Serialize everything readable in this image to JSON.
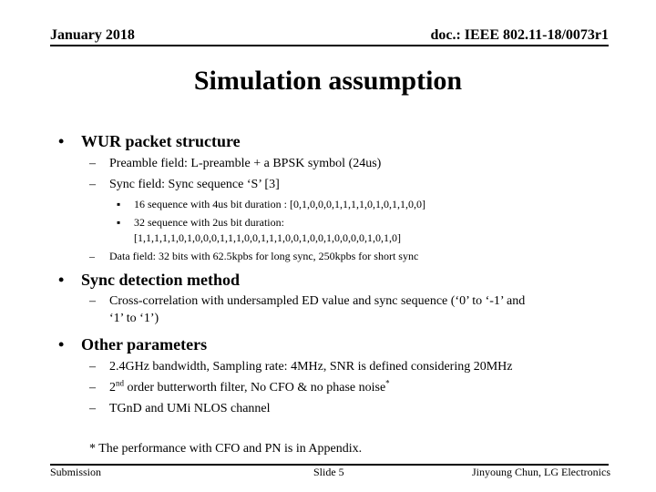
{
  "header": {
    "date": "January 2018",
    "doc_id": "doc.: IEEE 802.11-18/0073r1"
  },
  "title": "Simulation assumption",
  "sections": [
    {
      "heading": "WUR packet structure",
      "items": [
        "Preamble field: L-preamble + a BPSK symbol (24us)",
        "Sync field: Sync sequence ‘S’ [3]"
      ],
      "sub_items": [
        "16 sequence with 4us bit duration : [0,1,0,0,0,1,1,1,1,0,1,0,1,1,0,0]",
        "32 sequence with 2us bit duration:",
        "[1,1,1,1,1,0,1,0,0,0,1,1,1,0,0,1,1,1,0,0,1,0,0,1,0,0,0,0,1,0,1,0]"
      ],
      "items_after": [
        "Data field: 32 bits with 62.5kpbs for long sync, 250kpbs for short sync"
      ]
    },
    {
      "heading": "Sync detection method",
      "items": [
        "Cross-correlation with undersampled ED value and sync sequence (‘0’ to ‘-1’ and",
        "‘1’ to ‘1’)"
      ]
    },
    {
      "heading": "Other parameters",
      "items": [
        "2.4GHz bandwidth, Sampling rate: 4MHz, SNR is defined considering 20MHz",
        "2",
        "nd",
        " order butterworth filter, No CFO & no phase noise",
        "*",
        "TGnD and UMi NLOS channel"
      ]
    }
  ],
  "footnote": "* The performance with CFO and PN is in Appendix.",
  "footer": {
    "left": "Submission",
    "center": "Slide 5",
    "right": "Jinyoung Chun, LG Electronics"
  },
  "glyphs": {
    "bullet": "•",
    "dash": "–",
    "square_bullet": "▪"
  }
}
